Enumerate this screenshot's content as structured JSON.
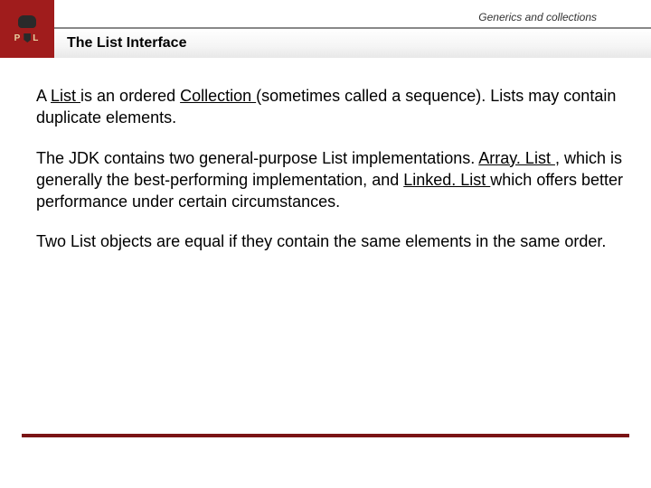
{
  "header": {
    "topic": "Generics and collections",
    "title": "The List Interface",
    "logo_letters_left": "P",
    "logo_letters_right": "L"
  },
  "body": {
    "p1_a": "A ",
    "p1_link1": "List ",
    "p1_b": "is an ordered ",
    "p1_link2": "Collection ",
    "p1_c": "(sometimes called a sequence). Lists may contain duplicate elements.",
    "p2_a": "The JDK contains two general-purpose List implementations. ",
    "p2_link1": "Array. List ",
    "p2_b": ", which is generally the best-performing implementation, and ",
    "p2_link2": "Linked. List ",
    "p2_c": "which offers better performance under certain circumstances.",
    "p3": "Two List objects are equal if they contain the same elements in the same order."
  },
  "colors": {
    "brand_red": "#a01c1c",
    "rule_red": "#7a1415"
  }
}
